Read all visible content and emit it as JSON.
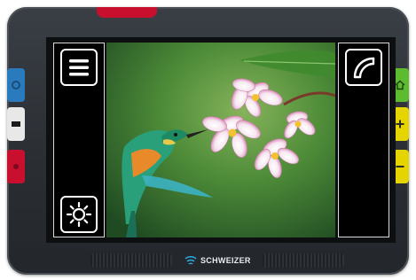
{
  "device": {
    "brand": "SCHWEIZER",
    "colors": {
      "red": "#c8102e",
      "blue": "#2a7bbd",
      "white": "#e8e8e8",
      "green": "#5dbb2f",
      "yellow": "#e6d400"
    }
  },
  "left_buttons": [
    {
      "name": "blue-button",
      "icon": "circle-icon"
    },
    {
      "name": "white-button",
      "icon": "rectangle-icon"
    },
    {
      "name": "red-button",
      "icon": "dot-icon"
    }
  ],
  "right_buttons": [
    {
      "name": "home-button",
      "icon": "home-icon"
    },
    {
      "name": "zoom-in-button",
      "icon": "plus-icon"
    },
    {
      "name": "zoom-out-button",
      "icon": "minus-icon"
    }
  ],
  "screen": {
    "menu_icon": "menu-icon",
    "brightness_icon": "brightness-icon",
    "curve_icon": "curve-icon",
    "image_subject": "hummingbird-and-flowers"
  }
}
